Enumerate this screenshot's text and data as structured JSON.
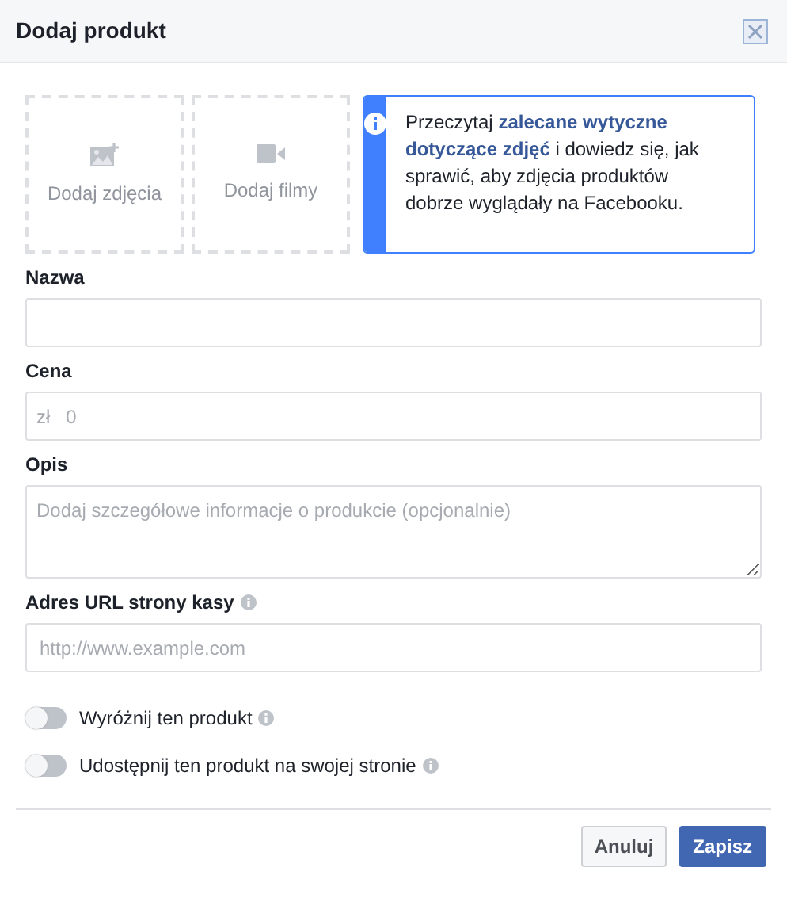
{
  "dialog": {
    "title": "Dodaj produkt"
  },
  "media_tiles": [
    {
      "kind": "photo",
      "label": "Dodaj zdjęcia"
    },
    {
      "kind": "video",
      "label": "Dodaj filmy"
    }
  ],
  "notice": {
    "text": "Przeczytaj **zalecane wytyczne dotyczące zdjęć** i dowiedz się, jak sprawić, aby zdjęcia produktów dobrze wyglądały na Facebooku."
  },
  "fields": [
    {
      "kind": "text",
      "label": "Nazwa",
      "help": false
    },
    {
      "kind": "price",
      "label": "Cena",
      "prefix": "zł",
      "value": "0",
      "help": false
    },
    {
      "kind": "textarea",
      "label": "Opis",
      "placeholder": "Dodaj szczegółowe informacje o produkcie (opcjonalnie)",
      "help": false
    },
    {
      "kind": "text",
      "label": "Adres URL strony kasy",
      "placeholder": "http://www.example.com",
      "help": true
    }
  ],
  "toggles": [
    {
      "label": "Wyróżnij ten produkt",
      "on": false
    },
    {
      "label": "Udostępnij ten produkt na swojej stronie",
      "on": false
    }
  ],
  "buttons": [
    {
      "label": "Anuluj",
      "kind": "secondary"
    },
    {
      "label": "Zapisz",
      "kind": "primary"
    }
  ]
}
